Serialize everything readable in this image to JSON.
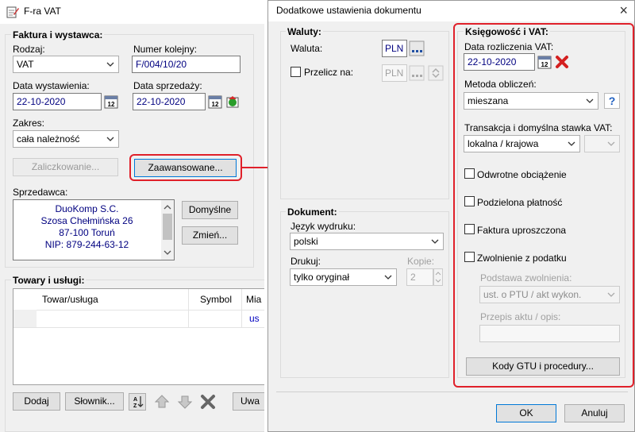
{
  "invoice_window": {
    "title": "F-ra VAT",
    "invoice_section": {
      "title": "Faktura i wystawca:",
      "type_label": "Rodzaj:",
      "type_value": "VAT",
      "number_label": "Numer kolejny:",
      "number_value": "F/004/10/20",
      "issue_date_label": "Data wystawienia:",
      "issue_date_value": "22-10-2020",
      "sale_date_label": "Data sprzedaży:",
      "sale_date_value": "22-10-2020",
      "scope_label": "Zakres:",
      "scope_value": "cała należność",
      "advance_button": "Zaliczkowanie...",
      "advanced_button": "Zaawansowane...",
      "seller_label": "Sprzedawca:",
      "seller_lines": [
        "DuoKomp S.C.",
        "Szosa Chełmińska 26",
        "87-100 Toruń",
        "NIP: 879-244-63-12"
      ],
      "default_button": "Domyślne",
      "change_button": "Zmień..."
    },
    "goods_section": {
      "title": "Towary i usługi:",
      "columns": [
        "Towar/usługa",
        "Symbol",
        "Mia"
      ],
      "first_row_partial": "us",
      "add_button": "Dodaj",
      "dictionary_button": "Słownik...",
      "notes_button": "Uwa"
    }
  },
  "dialog": {
    "title": "Dodatkowe ustawienia dokumentu",
    "close_glyph": "×",
    "currency": {
      "title": "Waluty:",
      "currency_label": "Waluta:",
      "currency_value": "PLN",
      "convert_label": "Przelicz na:",
      "convert_value": "PLN"
    },
    "document": {
      "title": "Dokument:",
      "language_label": "Język wydruku:",
      "language_value": "polski",
      "print_label": "Drukuj:",
      "print_value": "tylko oryginał",
      "copies_label": "Kopie:",
      "copies_value": "2"
    },
    "accounting": {
      "title": "Księgowość i VAT:",
      "vat_date_label": "Data rozliczenia VAT:",
      "vat_date_value": "22-10-2020",
      "method_label": "Metoda obliczeń:",
      "method_value": "mieszana",
      "help_glyph": "?",
      "transaction_label": "Transakcja i domyślna stawka VAT:",
      "transaction_value": "lokalna / krajowa",
      "reverse_charge": "Odwrotne obciążenie",
      "split_payment": "Podzielona płatność",
      "simplified_invoice": "Faktura uproszczona",
      "tax_exemption": "Zwolnienie z podatku",
      "exemption_basis_label": "Podstawa zwolnienia:",
      "exemption_basis_value": "ust. o PTU / akt wykon.",
      "legal_act_label": "Przepis aktu / opis:",
      "gtu_button": "Kody GTU i procedury..."
    },
    "ok_button": "OK",
    "cancel_button": "Anuluj"
  },
  "colors": {
    "highlight": "#e0202a",
    "accent_blue": "#0078d7",
    "seller_text": "#000080"
  }
}
